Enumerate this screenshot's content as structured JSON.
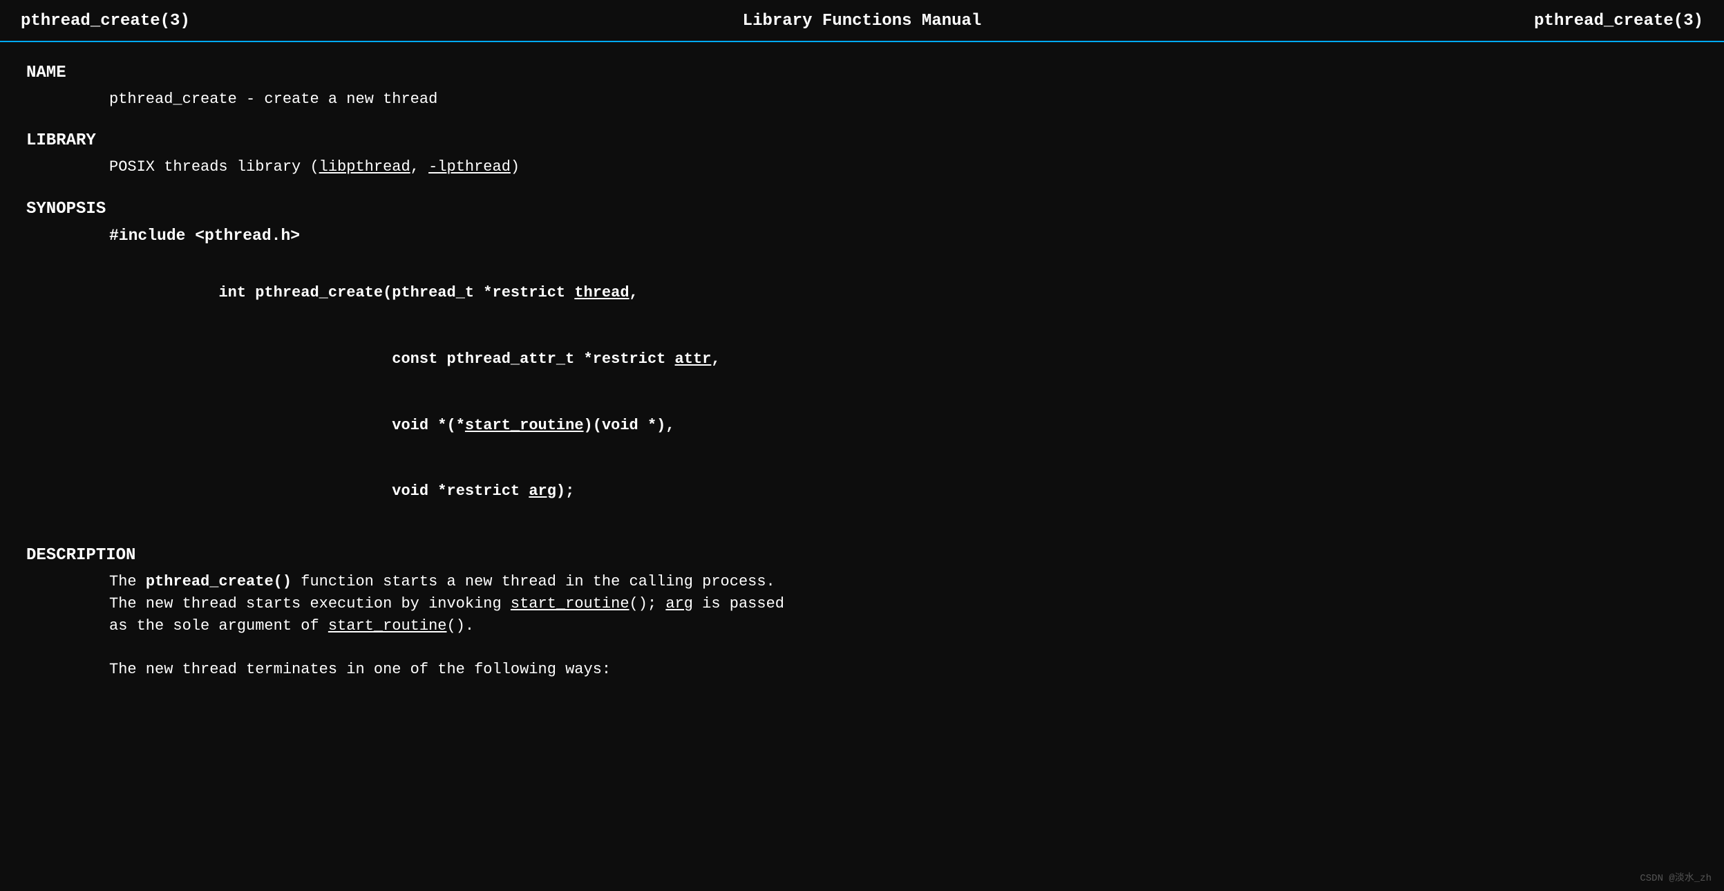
{
  "header": {
    "left": "pthread_create(3)",
    "center": "Library Functions Manual",
    "right": "pthread_create(3)"
  },
  "sections": {
    "name": {
      "label": "NAME",
      "body": "pthread_create - create a new thread"
    },
    "library": {
      "label": "LIBRARY",
      "prefix": "POSIX threads library (",
      "link1": "libpthread",
      "comma": ", ",
      "link2": "-lpthread",
      "suffix": ")"
    },
    "synopsis": {
      "label": "SYNOPSIS",
      "include": "#include <pthread.h>",
      "func_line1": "int pthread_create(pthread_t *restrict ",
      "func_link1": "thread",
      "func_line1_end": ",",
      "func_line2": "                   const pthread_attr_t *restrict ",
      "func_link2": "attr",
      "func_line2_end": ",",
      "func_line3": "                   void *(*",
      "func_link3": "start_routine",
      "func_line3_end": ")(void *),",
      "func_line4": "                   void *restrict ",
      "func_link4": "arg",
      "func_line4_end": ");"
    },
    "description": {
      "label": "DESCRIPTION",
      "para1_prefix": "The  ",
      "para1_bold": "pthread_create()",
      "para1_mid": "  function starts a new thread in the calling process.",
      "para2": "The new thread starts execution by invoking ",
      "para2_link1": "start_routine",
      "para2_mid": "(); ",
      "para2_link2": "arg",
      "para2_end": " is  passed",
      "para3_prefix": "as the sole argument of ",
      "para3_link": "start_routine",
      "para3_end": "().",
      "para4": "The new thread terminates in one of the following ways:"
    }
  },
  "watermark": "CSDN @淡水_zh"
}
